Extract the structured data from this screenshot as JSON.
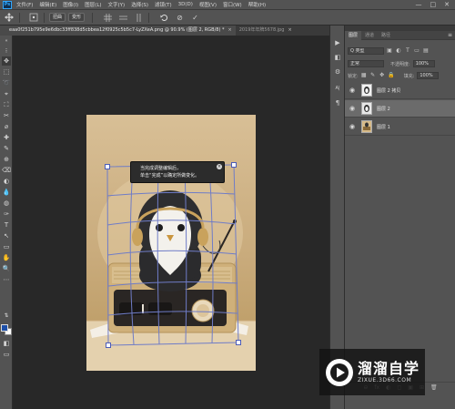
{
  "app": {
    "logo_text": "Ps"
  },
  "menu": [
    "文件(F)",
    "编辑(E)",
    "图像(I)",
    "图层(L)",
    "文字(Y)",
    "选择(S)",
    "滤镜(T)",
    "3D(D)",
    "视图(V)",
    "窗口(W)",
    "帮助(H)"
  ],
  "window_controls": {
    "minimize": "—",
    "maximize": "□",
    "close": "✕"
  },
  "options_bar": {
    "tool_icon": "move-icon",
    "buttons": [
      "扭曲",
      "变形"
    ],
    "cancel_symbol": "⊘",
    "commit_symbol": "✓"
  },
  "tabs": [
    {
      "label": "eaa0f251b795e9e6dbc33ff838d5cbbea12f0925c5b5c7-LyZXeA.png @ 90.9% (图层 2, RGB/8) *",
      "close": "×",
      "active": true
    },
    {
      "label": "2019年年牌5678.jpg",
      "close": "×",
      "active": false
    }
  ],
  "toolbar": {
    "collapse": "«",
    "tools": [
      "⁝",
      "✥",
      "⬚",
      "➰",
      "⌖",
      "⛶",
      "✂",
      "⌀",
      "✚",
      "✎",
      "⊕",
      "⌫",
      "◐",
      "💧",
      "◍",
      "✑",
      "T",
      "↖",
      "▭",
      "✋",
      "🔍",
      "⋯"
    ],
    "bottom_tools": [
      "⇅",
      "◧",
      "▭"
    ]
  },
  "tooltip": {
    "line1": "当完成调整编辑后，",
    "line2": "单击“完成”以确定所做变化。",
    "close": "×"
  },
  "panel": {
    "tabs": [
      "图层",
      "通道",
      "路径"
    ],
    "menu_icon": "≡",
    "filter_label": "Q 类型",
    "blend_mode": "正常",
    "opacity_label": "不透明度:",
    "opacity_value": "100%",
    "lock_label": "锁定:",
    "fill_label": "填充:",
    "fill_value": "100%",
    "layers": [
      {
        "name": "图层 2 拷贝",
        "visible": true,
        "selected": false,
        "thumb": "#f2f2f2"
      },
      {
        "name": "图层 2",
        "visible": true,
        "selected": true,
        "thumb": "#e8e8e8"
      },
      {
        "name": "图层 1",
        "visible": true,
        "selected": false,
        "thumb": "#d7bb8a"
      }
    ],
    "bottom_icons": [
      "⊖",
      "fx",
      "◐",
      "◻",
      "▣",
      "⊞",
      "🗑"
    ]
  },
  "right_strip_icons": [
    "▶",
    "◧",
    "⚙",
    "A|",
    "¶"
  ],
  "watermark": {
    "title": "溜溜自学",
    "subtitle": "ZIXUE.3D66.COM"
  }
}
